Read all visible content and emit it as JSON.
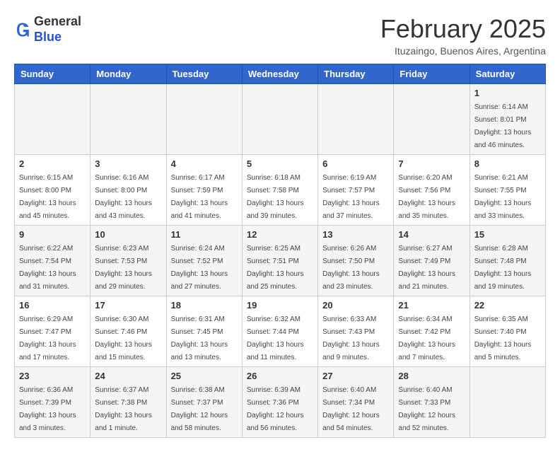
{
  "header": {
    "logo_general": "General",
    "logo_blue": "Blue",
    "month_title": "February 2025",
    "location": "Ituzaingo, Buenos Aires, Argentina"
  },
  "weekdays": [
    "Sunday",
    "Monday",
    "Tuesday",
    "Wednesday",
    "Thursday",
    "Friday",
    "Saturday"
  ],
  "weeks": [
    [
      {
        "day": "",
        "info": ""
      },
      {
        "day": "",
        "info": ""
      },
      {
        "day": "",
        "info": ""
      },
      {
        "day": "",
        "info": ""
      },
      {
        "day": "",
        "info": ""
      },
      {
        "day": "",
        "info": ""
      },
      {
        "day": "1",
        "info": "Sunrise: 6:14 AM\nSunset: 8:01 PM\nDaylight: 13 hours\nand 46 minutes."
      }
    ],
    [
      {
        "day": "2",
        "info": "Sunrise: 6:15 AM\nSunset: 8:00 PM\nDaylight: 13 hours\nand 45 minutes."
      },
      {
        "day": "3",
        "info": "Sunrise: 6:16 AM\nSunset: 8:00 PM\nDaylight: 13 hours\nand 43 minutes."
      },
      {
        "day": "4",
        "info": "Sunrise: 6:17 AM\nSunset: 7:59 PM\nDaylight: 13 hours\nand 41 minutes."
      },
      {
        "day": "5",
        "info": "Sunrise: 6:18 AM\nSunset: 7:58 PM\nDaylight: 13 hours\nand 39 minutes."
      },
      {
        "day": "6",
        "info": "Sunrise: 6:19 AM\nSunset: 7:57 PM\nDaylight: 13 hours\nand 37 minutes."
      },
      {
        "day": "7",
        "info": "Sunrise: 6:20 AM\nSunset: 7:56 PM\nDaylight: 13 hours\nand 35 minutes."
      },
      {
        "day": "8",
        "info": "Sunrise: 6:21 AM\nSunset: 7:55 PM\nDaylight: 13 hours\nand 33 minutes."
      }
    ],
    [
      {
        "day": "9",
        "info": "Sunrise: 6:22 AM\nSunset: 7:54 PM\nDaylight: 13 hours\nand 31 minutes."
      },
      {
        "day": "10",
        "info": "Sunrise: 6:23 AM\nSunset: 7:53 PM\nDaylight: 13 hours\nand 29 minutes."
      },
      {
        "day": "11",
        "info": "Sunrise: 6:24 AM\nSunset: 7:52 PM\nDaylight: 13 hours\nand 27 minutes."
      },
      {
        "day": "12",
        "info": "Sunrise: 6:25 AM\nSunset: 7:51 PM\nDaylight: 13 hours\nand 25 minutes."
      },
      {
        "day": "13",
        "info": "Sunrise: 6:26 AM\nSunset: 7:50 PM\nDaylight: 13 hours\nand 23 minutes."
      },
      {
        "day": "14",
        "info": "Sunrise: 6:27 AM\nSunset: 7:49 PM\nDaylight: 13 hours\nand 21 minutes."
      },
      {
        "day": "15",
        "info": "Sunrise: 6:28 AM\nSunset: 7:48 PM\nDaylight: 13 hours\nand 19 minutes."
      }
    ],
    [
      {
        "day": "16",
        "info": "Sunrise: 6:29 AM\nSunset: 7:47 PM\nDaylight: 13 hours\nand 17 minutes."
      },
      {
        "day": "17",
        "info": "Sunrise: 6:30 AM\nSunset: 7:46 PM\nDaylight: 13 hours\nand 15 minutes."
      },
      {
        "day": "18",
        "info": "Sunrise: 6:31 AM\nSunset: 7:45 PM\nDaylight: 13 hours\nand 13 minutes."
      },
      {
        "day": "19",
        "info": "Sunrise: 6:32 AM\nSunset: 7:44 PM\nDaylight: 13 hours\nand 11 minutes."
      },
      {
        "day": "20",
        "info": "Sunrise: 6:33 AM\nSunset: 7:43 PM\nDaylight: 13 hours\nand 9 minutes."
      },
      {
        "day": "21",
        "info": "Sunrise: 6:34 AM\nSunset: 7:42 PM\nDaylight: 13 hours\nand 7 minutes."
      },
      {
        "day": "22",
        "info": "Sunrise: 6:35 AM\nSunset: 7:40 PM\nDaylight: 13 hours\nand 5 minutes."
      }
    ],
    [
      {
        "day": "23",
        "info": "Sunrise: 6:36 AM\nSunset: 7:39 PM\nDaylight: 13 hours\nand 3 minutes."
      },
      {
        "day": "24",
        "info": "Sunrise: 6:37 AM\nSunset: 7:38 PM\nDaylight: 13 hours\nand 1 minute."
      },
      {
        "day": "25",
        "info": "Sunrise: 6:38 AM\nSunset: 7:37 PM\nDaylight: 12 hours\nand 58 minutes."
      },
      {
        "day": "26",
        "info": "Sunrise: 6:39 AM\nSunset: 7:36 PM\nDaylight: 12 hours\nand 56 minutes."
      },
      {
        "day": "27",
        "info": "Sunrise: 6:40 AM\nSunset: 7:34 PM\nDaylight: 12 hours\nand 54 minutes."
      },
      {
        "day": "28",
        "info": "Sunrise: 6:40 AM\nSunset: 7:33 PM\nDaylight: 12 hours\nand 52 minutes."
      },
      {
        "day": "",
        "info": ""
      }
    ]
  ]
}
